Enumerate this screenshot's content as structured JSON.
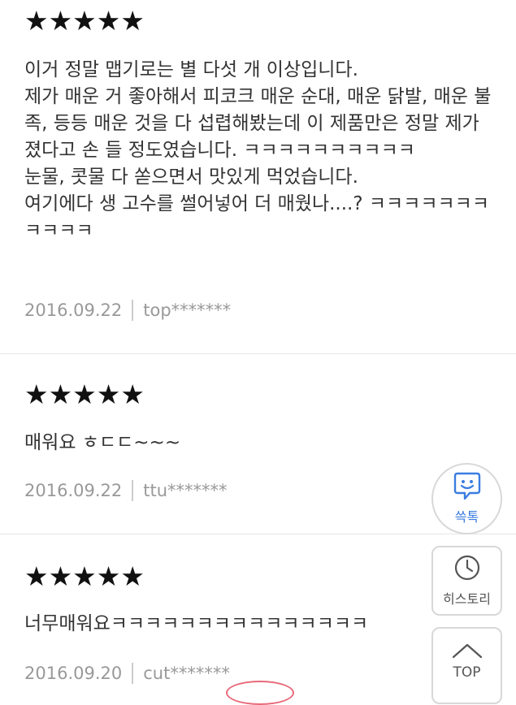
{
  "reviews": [
    {
      "stars": "★★★★★",
      "rating": 5,
      "body": "이거 정말 맵기로는 별 다섯 개 이상입니다.\n제가 매운 거 좋아해서 피코크 매운 순대, 매운 닭발, 매운 불족, 등등 매운 것을 다 섭렵해봤는데 이 제품만은 정말 제가 졌다고 손 들 정도였습니다. ㅋㅋㅋㅋㅋㅋㅋㅋㅋㅋ\n눈물, 콧물 다 쏟으면서 맛있게 먹었습니다.\n여기에다 생 고수를 썰어넣어 더 매웠나....? ㅋㅋㅋㅋㅋㅋㅋㅋㅋㅋㅋ",
      "date": "2016.09.22",
      "user": "top*******"
    },
    {
      "stars": "★★★★★",
      "rating": 5,
      "body": "매워요 ㅎㄷㄷ~~~",
      "date": "2016.09.22",
      "user": "ttu*******"
    },
    {
      "stars": "★★★★★",
      "rating": 5,
      "body": "너무매워요ㅋㅋㅋㅋㅋㅋㅋㅋㅋㅋㅋㅋㅋㅋㅋ",
      "date": "2016.09.20",
      "user": "cut*******"
    }
  ],
  "floating": {
    "talk_label": "쓱톡",
    "history_label": "히스토리",
    "top_label": "TOP"
  },
  "icons": {
    "talk": "chat-bubble-smile-icon",
    "history": "clock-icon",
    "top": "chevron-up-icon"
  },
  "colors": {
    "talk_accent": "#3b7de0",
    "meta_text": "#999999",
    "oval_accent": "#e86a7a"
  }
}
